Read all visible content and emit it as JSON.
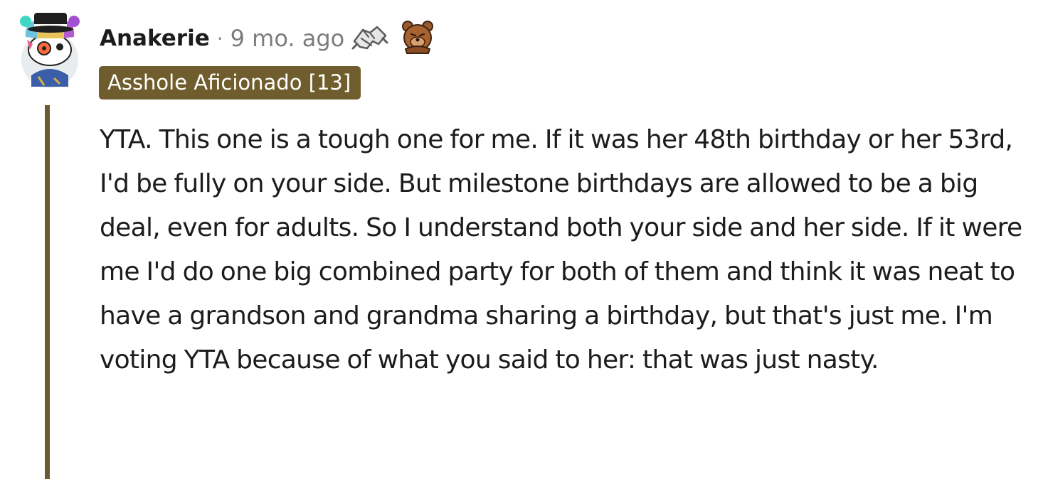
{
  "comment": {
    "username": "Anakerie",
    "separator": "·",
    "timestamp": "9 mo. ago",
    "flair": "Asshole Aficionado [13]",
    "body": "YTA. This one is a tough one for me. If it was her 48th birthday or her 53rd, I'd be fully on your side. But milestone birthdays are allowed to be a big deal, even for adults. So I understand both your side and her side. If it were me I'd do one big combined party for both of them and think it was neat to have a grandson and grandma sharing a birthday, but that's just me. I'm voting YTA because of what you said to her: that was just nasty.",
    "awards": [
      {
        "icon": "handshake-icon"
      },
      {
        "icon": "bear-facepalm-icon"
      }
    ]
  },
  "colors": {
    "flair_background": "#6f5d2d",
    "thread_line": "#6b5b33",
    "timestamp": "#7c7c7c"
  }
}
